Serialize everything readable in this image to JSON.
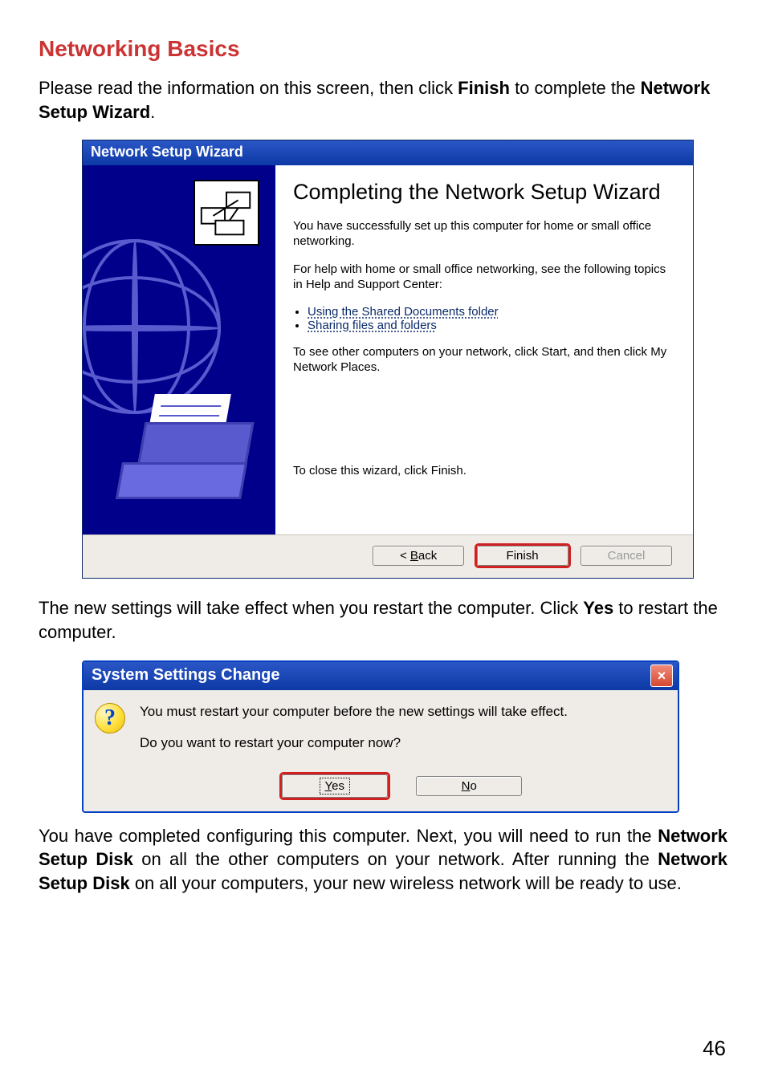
{
  "heading": "Networking Basics",
  "intro_plain_prefix": "Please read the information on this screen, then click ",
  "intro_bold_1": "Finish",
  "intro_middle": " to complete the ",
  "intro_bold_2": "Network Setup Wizard",
  "intro_suffix": ".",
  "wizard": {
    "title": "Network Setup Wizard",
    "heading": "Completing the Network Setup Wizard",
    "p1": "You have successfully set up this computer for home or small office networking.",
    "p2": "For help with home or small office networking, see the following topics in Help and Support Center:",
    "link1": "Using the Shared Documents folder",
    "link2": "Sharing files and folders",
    "p3": "To see other computers on your network, click Start, and then click My Network Places.",
    "closeLine": "To close this wizard, click Finish.",
    "buttons": {
      "back_prefix": "< ",
      "back_u": "B",
      "back_rest": "ack",
      "finish": "Finish",
      "cancel": "Cancel"
    }
  },
  "mid_prefix": "The new settings will take effect when you restart the computer. Click ",
  "mid_bold": "Yes",
  "mid_suffix": " to restart the computer.",
  "dialog": {
    "title": "System Settings Change",
    "line1": "You must restart your computer before the new settings will take effect.",
    "line2": "Do you want to restart your computer now?",
    "yes_u": "Y",
    "yes_rest": "es",
    "no_u": "N",
    "no_rest": "o"
  },
  "outro_1": "You have completed configuring this computer. Next, you will need to run the ",
  "outro_b1": "Network Setup Disk",
  "outro_2": " on all the other computers on your network. After running the ",
  "outro_b2": "Network Setup Disk",
  "outro_3": " on all your computers, your new wireless network will be ready to use.",
  "pageNumber": "46"
}
